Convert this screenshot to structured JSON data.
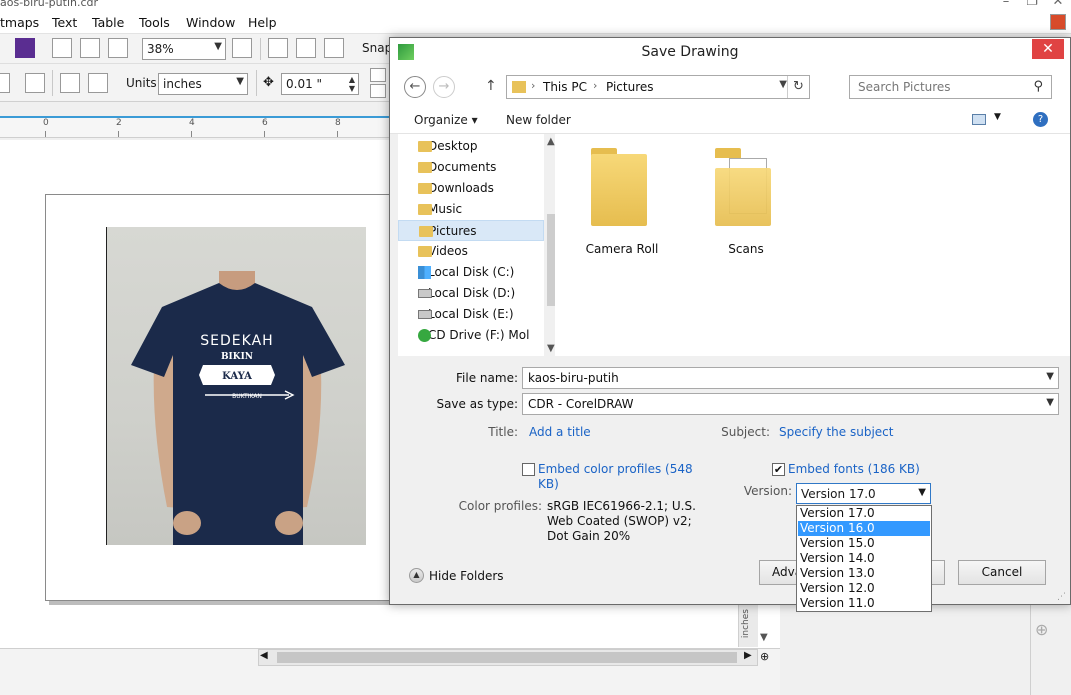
{
  "app": {
    "title": "aos-biru-putih.cdr",
    "menu": [
      "tmaps",
      "Text",
      "Table",
      "Tools",
      "Window",
      "Help"
    ],
    "zoom": "38%",
    "snap_label": "Snap",
    "units_label": "Units:",
    "units_value": "inches",
    "nudge_value": "0.01 \"",
    "ruler_ticks": [
      "0",
      "2",
      "4",
      "6",
      "8"
    ],
    "vertical_ruler_unit": "inches"
  },
  "tshirt": {
    "line1": "SEDEKAH",
    "line2": "BIKIN",
    "line3": "KAYA",
    "line4": "BUKTIKAN"
  },
  "dialog": {
    "title": "Save Drawing",
    "close_glyph": "✕",
    "breadcrumb": [
      "This PC",
      "Pictures"
    ],
    "search_placeholder": "Search Pictures",
    "organize_label": "Organize ▾",
    "new_folder_label": "New folder",
    "tree": [
      {
        "label": "Desktop",
        "icon": "folder-icon"
      },
      {
        "label": "Documents",
        "icon": "folder-icon"
      },
      {
        "label": "Downloads",
        "icon": "folder-icon"
      },
      {
        "label": "Music",
        "icon": "folder-icon"
      },
      {
        "label": "Pictures",
        "icon": "folder-icon",
        "selected": true
      },
      {
        "label": "Videos",
        "icon": "folder-icon"
      },
      {
        "label": "Local Disk (C:)",
        "icon": "windows-drive-icon"
      },
      {
        "label": "Local Disk (D:)",
        "icon": "drive-icon"
      },
      {
        "label": "Local Disk (E:)",
        "icon": "drive-icon"
      },
      {
        "label": "CD Drive (F:) Mol",
        "icon": "cd-icon"
      }
    ],
    "folders": [
      {
        "label": "Camera Roll"
      },
      {
        "label": "Scans"
      }
    ],
    "file_name_label": "File name:",
    "file_name_value": "kaos-biru-putih",
    "save_type_label": "Save as type:",
    "save_type_value": "CDR - CorelDRAW",
    "title_label": "Title:",
    "title_link": "Add a title",
    "subject_label": "Subject:",
    "subject_link": "Specify the subject",
    "embed_profiles_line1": "Embed color profiles (548",
    "embed_profiles_line2": "KB)",
    "embed_profiles_checked": false,
    "embed_fonts_label": "Embed fonts (186 KB)",
    "embed_fonts_checked": true,
    "color_profiles_label": "Color profiles:",
    "color_profiles_line1": "sRGB IEC61966-2.1; U.S.",
    "color_profiles_line2": "Web Coated (SWOP) v2;",
    "color_profiles_line3": "Dot Gain 20%",
    "version_label": "Version:",
    "version_value": "Version 17.0",
    "version_options": [
      "Version 17.0",
      "Version 16.0",
      "Version 15.0",
      "Version 14.0",
      "Version 13.0",
      "Version 12.0",
      "Version 11.0"
    ],
    "version_highlighted": "Version 16.0",
    "hide_folders_label": "Hide Folders",
    "advanced_label": "Adva",
    "cancel_label": "Cancel"
  },
  "colors": {
    "accent": "#3399ff",
    "link": "#1a63c6",
    "close": "#e04343",
    "shirt": "#1b2a4a"
  }
}
